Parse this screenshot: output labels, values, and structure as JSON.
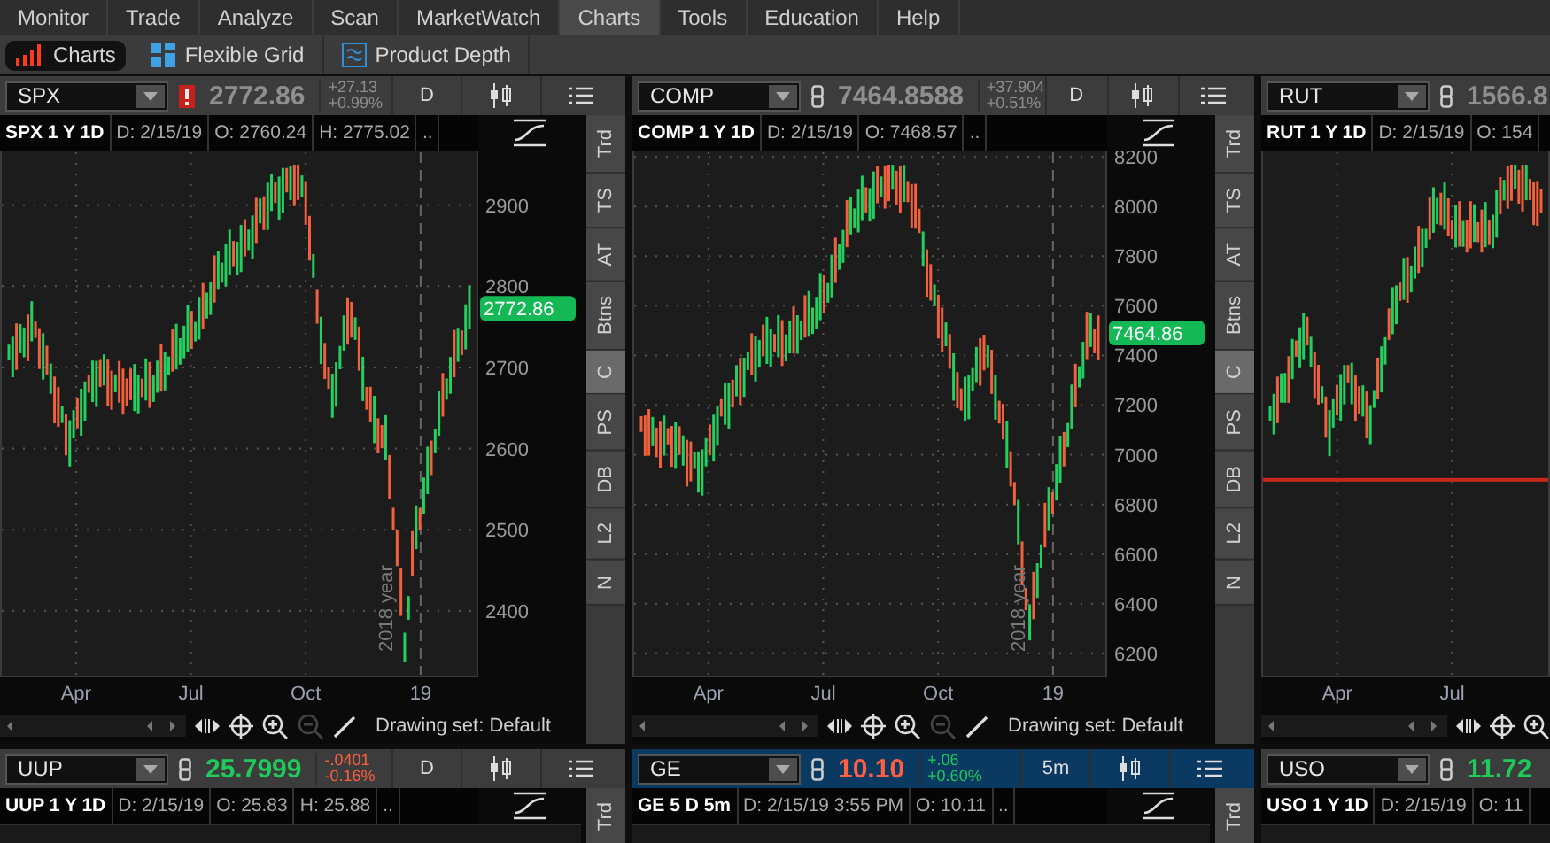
{
  "menu": [
    {
      "label": "Monitor",
      "selected": false
    },
    {
      "label": "Trade",
      "selected": false
    },
    {
      "label": "Analyze",
      "selected": false
    },
    {
      "label": "Scan",
      "selected": false
    },
    {
      "label": "MarketWatch",
      "selected": false
    },
    {
      "label": "Charts",
      "selected": true
    },
    {
      "label": "Tools",
      "selected": false
    },
    {
      "label": "Education",
      "selected": false
    },
    {
      "label": "Help",
      "selected": false
    }
  ],
  "subtabs": [
    {
      "label": "Charts",
      "selected": true
    },
    {
      "label": "Flexible Grid",
      "selected": false
    },
    {
      "label": "Product Depth",
      "selected": false
    }
  ],
  "top_row": [
    {
      "symbol": "SPX",
      "alert": true,
      "price": "2772.86",
      "color": "#8e8e8e",
      "change": {
        "value": "+27.13",
        "percent": "+0.99%",
        "color": "#8e8e8e"
      },
      "aggregation": "D",
      "active": false,
      "info": [
        "SPX 1 Y 1D",
        "D: 2/15/19",
        "O: 2760.24",
        "H: 2775.02",
        ".."
      ],
      "y_ticks": [
        "2900",
        "2800",
        "2700",
        "2600",
        "2500",
        "2400"
      ],
      "last_price": "2772.86",
      "x_labels": [
        "Apr",
        "Jul",
        "Oct",
        "19"
      ],
      "year_marker": "2018 year",
      "support_line": false,
      "side_tabs": [
        {
          "label": "Trd",
          "selected": false
        },
        {
          "label": "TS",
          "selected": false
        },
        {
          "label": "AT",
          "selected": false
        },
        {
          "label": "Btns",
          "selected": false
        },
        {
          "label": "C",
          "selected": true
        },
        {
          "label": "PS",
          "selected": false
        },
        {
          "label": "DB",
          "selected": false
        },
        {
          "label": "L2",
          "selected": false
        },
        {
          "label": "N",
          "selected": false
        }
      ],
      "drawing_set": "Drawing set: Default"
    },
    {
      "symbol": "COMP",
      "alert": false,
      "price": "7464.8588",
      "color": "#8e8e8e",
      "change": {
        "value": "+37.904",
        "percent": "+0.51%",
        "color": "#8e8e8e"
      },
      "aggregation": "D",
      "active": false,
      "info": [
        "COMP 1 Y 1D",
        "D: 2/15/19",
        "O: 7468.57",
        ".."
      ],
      "y_ticks": [
        "8200",
        "8000",
        "7800",
        "7600",
        "7400",
        "7200",
        "7000",
        "6800",
        "6600",
        "6400",
        "6200"
      ],
      "last_price": "7464.86",
      "x_labels": [
        "Apr",
        "Jul",
        "Oct",
        "19"
      ],
      "year_marker": "2018 year",
      "support_line": false,
      "side_tabs": [
        {
          "label": "Trd",
          "selected": false
        },
        {
          "label": "TS",
          "selected": false
        },
        {
          "label": "AT",
          "selected": false
        },
        {
          "label": "Btns",
          "selected": false
        },
        {
          "label": "C",
          "selected": true
        },
        {
          "label": "PS",
          "selected": false
        },
        {
          "label": "DB",
          "selected": false
        },
        {
          "label": "L2",
          "selected": false
        },
        {
          "label": "N",
          "selected": false
        }
      ],
      "drawing_set": "Drawing set: Default"
    },
    {
      "symbol": "RUT",
      "alert": false,
      "price": "1566.8",
      "color": "#8e8e8e",
      "active": false,
      "info": [
        "RUT 1 Y 1D",
        "D: 2/15/19",
        "O: 154"
      ],
      "x_labels": [
        "Apr",
        "Jul"
      ],
      "support_line": true
    }
  ],
  "bottom_row": [
    {
      "symbol": "UUP",
      "alert": false,
      "price": "25.7999",
      "color": "#1fc95a",
      "change": {
        "value": "-.0401",
        "percent": "-0.16%",
        "color": "#ff5f3f"
      },
      "aggregation": "D",
      "active": false,
      "info": [
        "UUP 1 Y 1D",
        "D: 2/15/19",
        "O: 25.83",
        "H: 25.88",
        ".."
      ],
      "side_tabs": [
        {
          "label": "Trd",
          "selected": false
        }
      ]
    },
    {
      "symbol": "GE",
      "alert": false,
      "price": "10.10",
      "color": "#ff5f3f",
      "change": {
        "value": "+.06",
        "percent": "+0.60%",
        "color": "#1fc95a"
      },
      "aggregation": "5m",
      "active": true,
      "info": [
        "GE 5 D 5m",
        "D: 2/15/19 3:55 PM",
        "O: 10.11",
        ".."
      ],
      "side_tabs": [
        {
          "label": "Trd",
          "selected": false
        }
      ]
    },
    {
      "symbol": "USO",
      "alert": false,
      "price": "11.72",
      "color": "#1fc95a",
      "active": false,
      "info": [
        "USO 1 Y 1D",
        "D: 2/15/19",
        "O: 11"
      ]
    }
  ]
}
